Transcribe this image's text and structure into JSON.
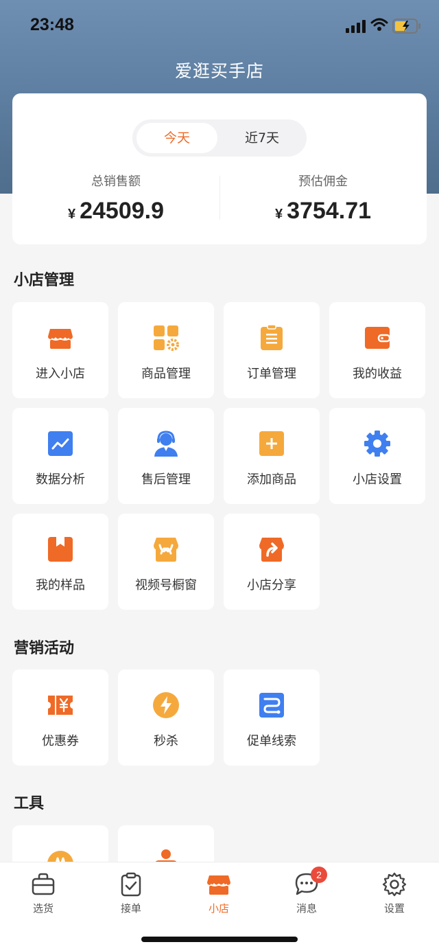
{
  "status_bar": {
    "time": "23:48"
  },
  "header": {
    "title": "爱逛买手店"
  },
  "summary": {
    "tabs": {
      "active": "今天",
      "inactive": "近7天"
    },
    "currency_symbol": "¥",
    "total_sales": {
      "label": "总销售额",
      "value": "24509.9"
    },
    "commission": {
      "label": "预估佣金",
      "value": "3754.71"
    }
  },
  "sections": {
    "shop": {
      "title": "小店管理",
      "items": [
        {
          "label": "进入小店",
          "icon": "shop-icon"
        },
        {
          "label": "商品管理",
          "icon": "product-grid-icon"
        },
        {
          "label": "订单管理",
          "icon": "clipboard-icon"
        },
        {
          "label": "我的收益",
          "icon": "wallet-icon"
        },
        {
          "label": "数据分析",
          "icon": "chart-icon"
        },
        {
          "label": "售后管理",
          "icon": "customer-service-icon"
        },
        {
          "label": "添加商品",
          "icon": "add-icon"
        },
        {
          "label": "小店设置",
          "icon": "gear-icon"
        },
        {
          "label": "我的样品",
          "icon": "sample-box-icon"
        },
        {
          "label": "视频号橱窗",
          "icon": "channels-window-icon"
        },
        {
          "label": "小店分享",
          "icon": "share-icon"
        }
      ]
    },
    "marketing": {
      "title": "营销活动",
      "items": [
        {
          "label": "优惠券",
          "icon": "coupon-icon"
        },
        {
          "label": "秒杀",
          "icon": "flash-icon"
        },
        {
          "label": "促单线索",
          "icon": "lead-icon"
        }
      ]
    },
    "tools": {
      "title": "工具"
    }
  },
  "tabbar": {
    "items": [
      {
        "label": "选货",
        "icon": "bag-icon"
      },
      {
        "label": "接单",
        "icon": "order-icon"
      },
      {
        "label": "小店",
        "icon": "shop-icon"
      },
      {
        "label": "消息",
        "icon": "message-icon",
        "badge": "2"
      },
      {
        "label": "设置",
        "icon": "settings-icon"
      }
    ],
    "active": "小店"
  },
  "colors": {
    "accent": "#ef6a26",
    "yellow": "#f5a93c",
    "blue": "#3f7ff0",
    "badge": "#ea4a3b"
  }
}
